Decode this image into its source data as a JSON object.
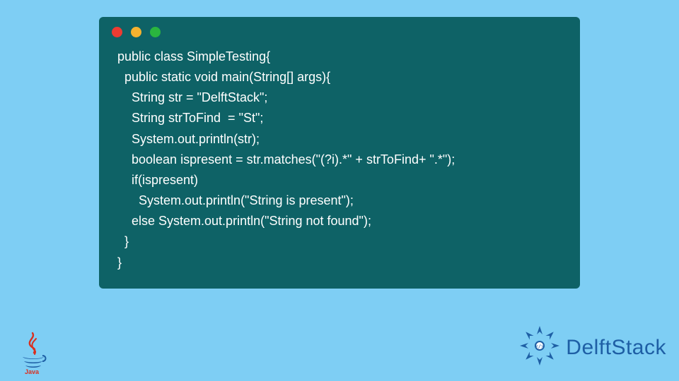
{
  "code_lines": [
    "public class SimpleTesting{",
    "  public static void main(String[] args){",
    "    String str = \"DelftStack\";",
    "    String strToFind  = \"St\";",
    "    System.out.println(str);",
    "    boolean ispresent = str.matches(\"(?i).*\" + strToFind+ \".*\");",
    "    if(ispresent)",
    "      System.out.println(\"String is present\");",
    "    else System.out.println(\"String not found\");",
    "  }",
    "}"
  ],
  "brand": {
    "name": "DelftStack"
  },
  "java_logo": {
    "label": "Java"
  }
}
